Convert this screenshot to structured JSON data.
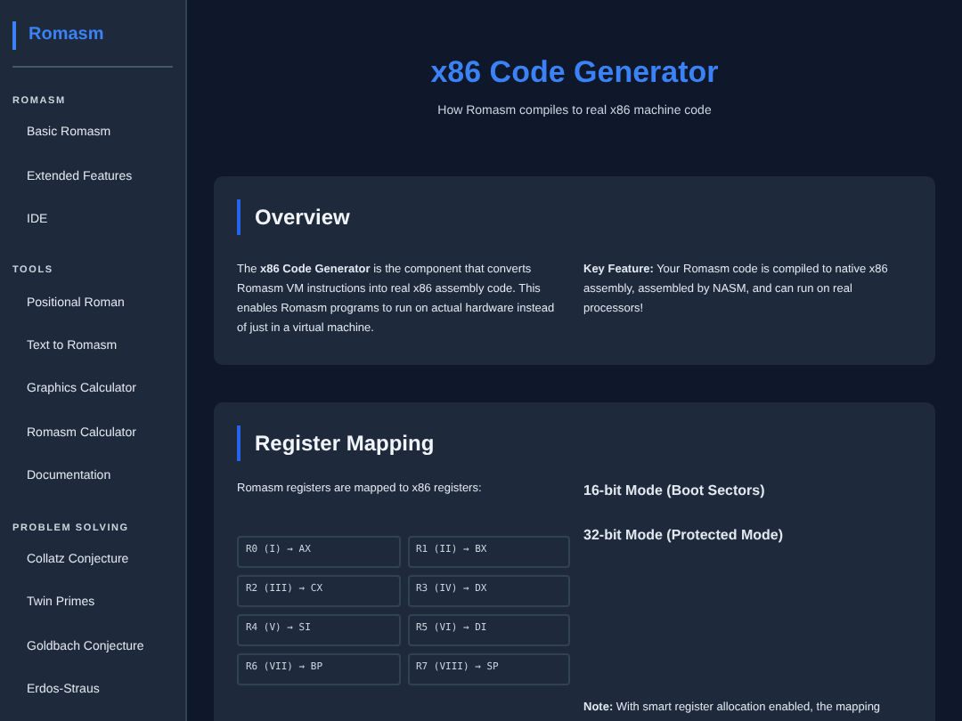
{
  "sidebar": {
    "logo": "Romasm",
    "sections": [
      {
        "title": "ROMASM",
        "items": [
          {
            "label": "Basic Romasm"
          },
          {
            "label": "Extended Features"
          },
          {
            "label": "IDE"
          }
        ]
      },
      {
        "title": "TOOLS",
        "items": [
          {
            "label": "Positional Roman"
          },
          {
            "label": "Text to Romasm"
          },
          {
            "label": "Graphics Calculator"
          },
          {
            "label": "Romasm Calculator"
          },
          {
            "label": "Documentation"
          }
        ]
      },
      {
        "title": "PROBLEM SOLVING",
        "items": [
          {
            "label": "Collatz Conjecture"
          },
          {
            "label": "Twin Primes"
          },
          {
            "label": "Goldbach Conjecture"
          },
          {
            "label": "Erdos-Straus"
          }
        ]
      }
    ]
  },
  "header": {
    "title": "x86 Code Generator",
    "subtitle": "How Romasm compiles to real x86 machine code"
  },
  "overview": {
    "title": "Overview",
    "text": "The **x86 Code Generator** is the component that converts Romasm VM instructions into real x86 assembly code. This enables Romasm programs to run on actual hardware instead of just in a virtual machine.",
    "feature": "**Key Feature:** Your Romasm code is compiled to native x86 assembly, assembled by NASM, and can run on real processors!"
  },
  "register_mapping": {
    "title": "Register Mapping",
    "intro": "Romasm registers are mapped to x86 registers:",
    "registers": [
      "R0 (I) → AX",
      "R1 (II) → BX",
      "R2 (III) → CX",
      "R3 (IV) → DX",
      "R4 (V) → SI",
      "R5 (VI) → DI",
      "R6 (VII) → BP",
      "R7 (VIII) → SP"
    ],
    "modes": [
      "16-bit Mode (Boot Sectors)",
      "32-bit Mode (Protected Mode)"
    ],
    "note": "**Note:** With smart register allocation enabled, the mapping"
  }
}
